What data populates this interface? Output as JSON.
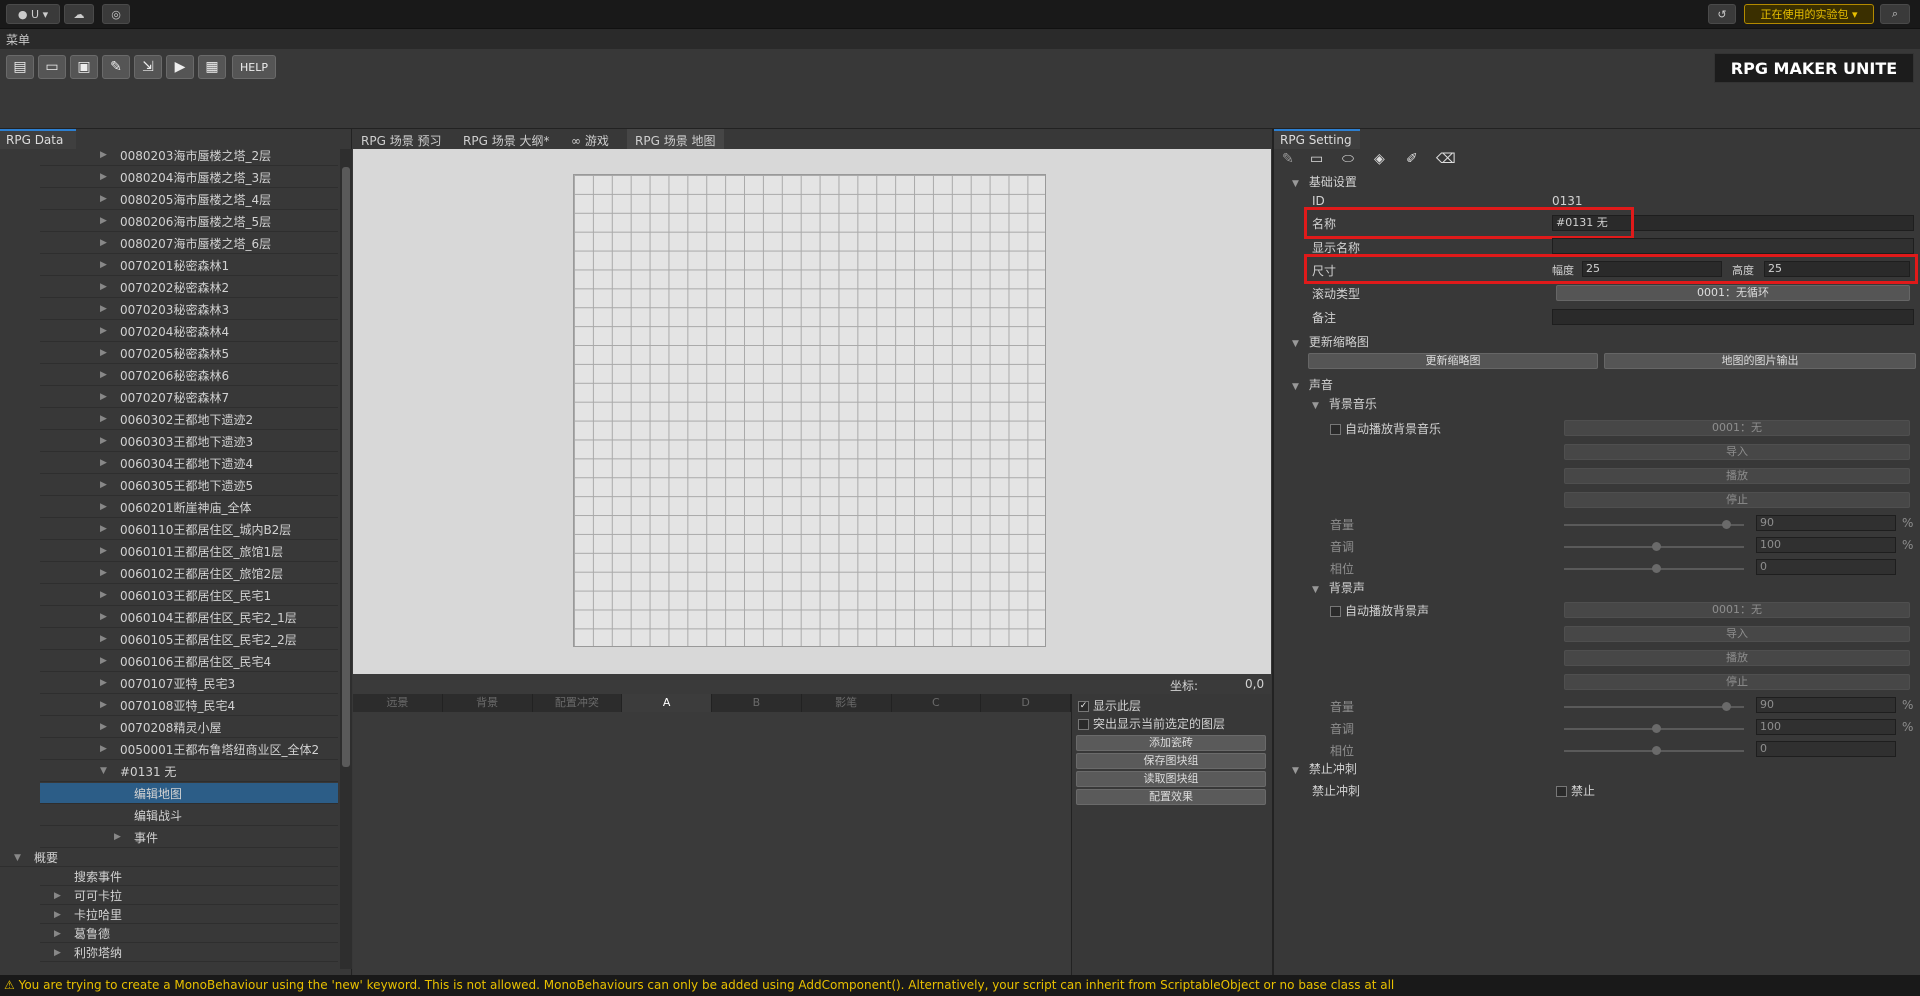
{
  "topbar": {
    "account_label": "U",
    "package_label": "正在使用的实验包"
  },
  "menubar": {
    "label": "菜单"
  },
  "toolbar": {
    "help_label": "HELP",
    "logo": "RPG MAKER UNITE"
  },
  "left": {
    "tab": "RPG Data",
    "items": [
      "0080203海市蜃楼之塔_2层",
      "0080204海市蜃楼之塔_3层",
      "0080205海市蜃楼之塔_4层",
      "0080206海市蜃楼之塔_5层",
      "0080207海市蜃楼之塔_6层",
      "0070201秘密森林1",
      "0070202秘密森林2",
      "0070203秘密森林3",
      "0070204秘密森林4",
      "0070205秘密森林5",
      "0070206秘密森林6",
      "0070207秘密森林7",
      "0060302王都地下遗迹2",
      "0060303王都地下遗迹3",
      "0060304王都地下遗迹4",
      "0060305王都地下遗迹5",
      "0060201断崖神庙_全体",
      "0060110王都居住区_城内B2层",
      "0060101王都居住区_旅馆1层",
      "0060102王都居住区_旅馆2层",
      "0060103王都居住区_民宅1",
      "0060104王都居住区_民宅2_1层",
      "0060105王都居住区_民宅2_2层",
      "0060106王都居住区_民宅4",
      "0070107亚特_民宅3",
      "0070108亚特_民宅4",
      "0070208精灵小屋",
      "0050001王都布鲁塔纽商业区_全体2"
    ],
    "current_map": "#0131 无",
    "sub_items": [
      "编辑地图",
      "编辑战斗",
      "事件"
    ],
    "overview": "概要",
    "overview_items": [
      "搜索事件",
      "可可卡拉",
      "卡拉哈里",
      "葛鲁德",
      "利弥塔纳"
    ]
  },
  "center": {
    "tabs": [
      "RPG 场景 预习",
      "RPG 场景 大纲*",
      "游戏",
      "RPG 场景 地图"
    ],
    "coord_label": "坐标:",
    "coord_value": "0,0",
    "layers": [
      "远景",
      "背景",
      "配置冲突",
      "A",
      "B",
      "影笔",
      "C",
      "D"
    ],
    "show_layer": "显示此层",
    "highlight_layer": "突出显示当前选定的图层",
    "buttons": [
      "添加瓷砖",
      "保存图块组",
      "读取图块组",
      "配置效果"
    ]
  },
  "right": {
    "tab": "RPG Setting",
    "basic": "基础设置",
    "id_label": "ID",
    "id_value": "0131",
    "name_label": "名称",
    "name_value": "#0131 无",
    "display_name_label": "显示名称",
    "size_label": "尺寸",
    "width_label": "幅度",
    "width_value": "25",
    "height_label": "高度",
    "height_value": "25",
    "scroll_label": "滚动类型",
    "scroll_value": "0001：无循环",
    "note_label": "备注",
    "thumb_section": "更新缩略图",
    "thumb_btn": "更新缩略图",
    "export_btn": "地图的图片输出",
    "sound": "声音",
    "bgm": "背景音乐",
    "auto_bgm": "自动播放背景音乐",
    "bgm_value": "0001：无",
    "import": "导入",
    "play": "播放",
    "stop": "停止",
    "volume": "音量",
    "pitch": "音调",
    "phase": "相位",
    "bgm_volume": "90",
    "bgm_pitch": "100",
    "bgm_phase": "0",
    "bgs": "背景声",
    "auto_bgs": "自动播放背景声",
    "bgs_value": "0001：无",
    "bgs_volume": "90",
    "bgs_pitch": "100",
    "bgs_phase": "0",
    "pct": "%",
    "dash_section": "禁止冲刺",
    "dash_label": "禁止冲刺",
    "dash_check": "禁止"
  },
  "status": {
    "message": "You are trying to create a MonoBehaviour using the 'new' keyword.  This is not allowed.  MonoBehaviours can only be added using AddComponent(). Alternatively, your script can inherit from ScriptableObject or no base class at all"
  }
}
